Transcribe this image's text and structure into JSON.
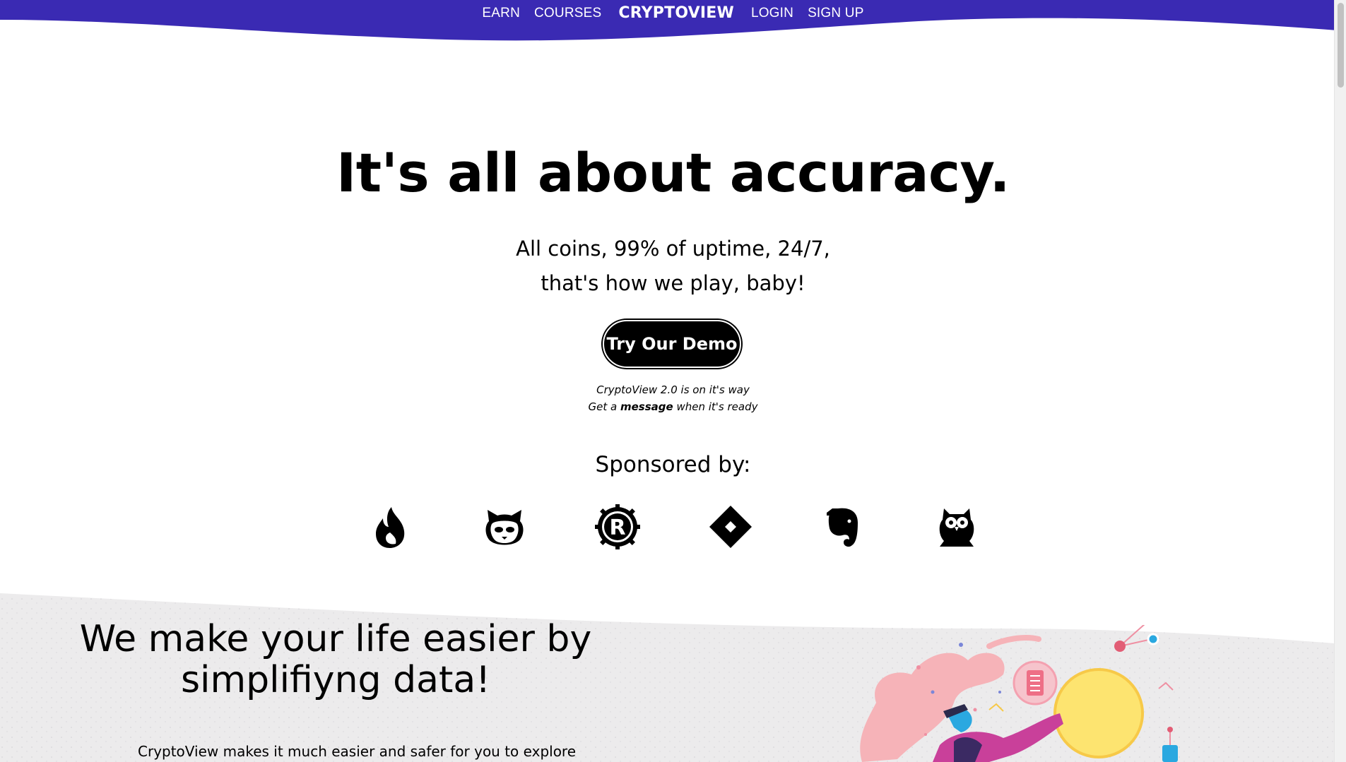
{
  "nav": {
    "items": [
      "EARN",
      "COURSES",
      "CRYPTOVIEW",
      "LOGIN",
      "SIGN UP"
    ],
    "bg_color": "#3a2ab3"
  },
  "hero": {
    "title": "It's all about accuracy.",
    "subtitle_line1": "All coins, 99% of uptime, 24/7,",
    "subtitle_line2": "that's how we play, baby!",
    "cta": "Try Our Demo",
    "note_line1": "CryptoView 2.0 is on it's way",
    "note_prefix": "Get a ",
    "note_bold": "message",
    "note_suffix": " when it's ready"
  },
  "sponsors": {
    "heading": "Sponsored by:",
    "icons": [
      "tinder-flame-icon",
      "napster-cat-icon",
      "rust-gear-icon",
      "diamond-logo-icon",
      "evernote-elephant-icon",
      "owl-logo-icon"
    ]
  },
  "features": {
    "title_line1": "We make your life easier by",
    "title_line2": "simplifiyng data!",
    "text": "CryptoView makes it much easier and safer for you to explore"
  }
}
